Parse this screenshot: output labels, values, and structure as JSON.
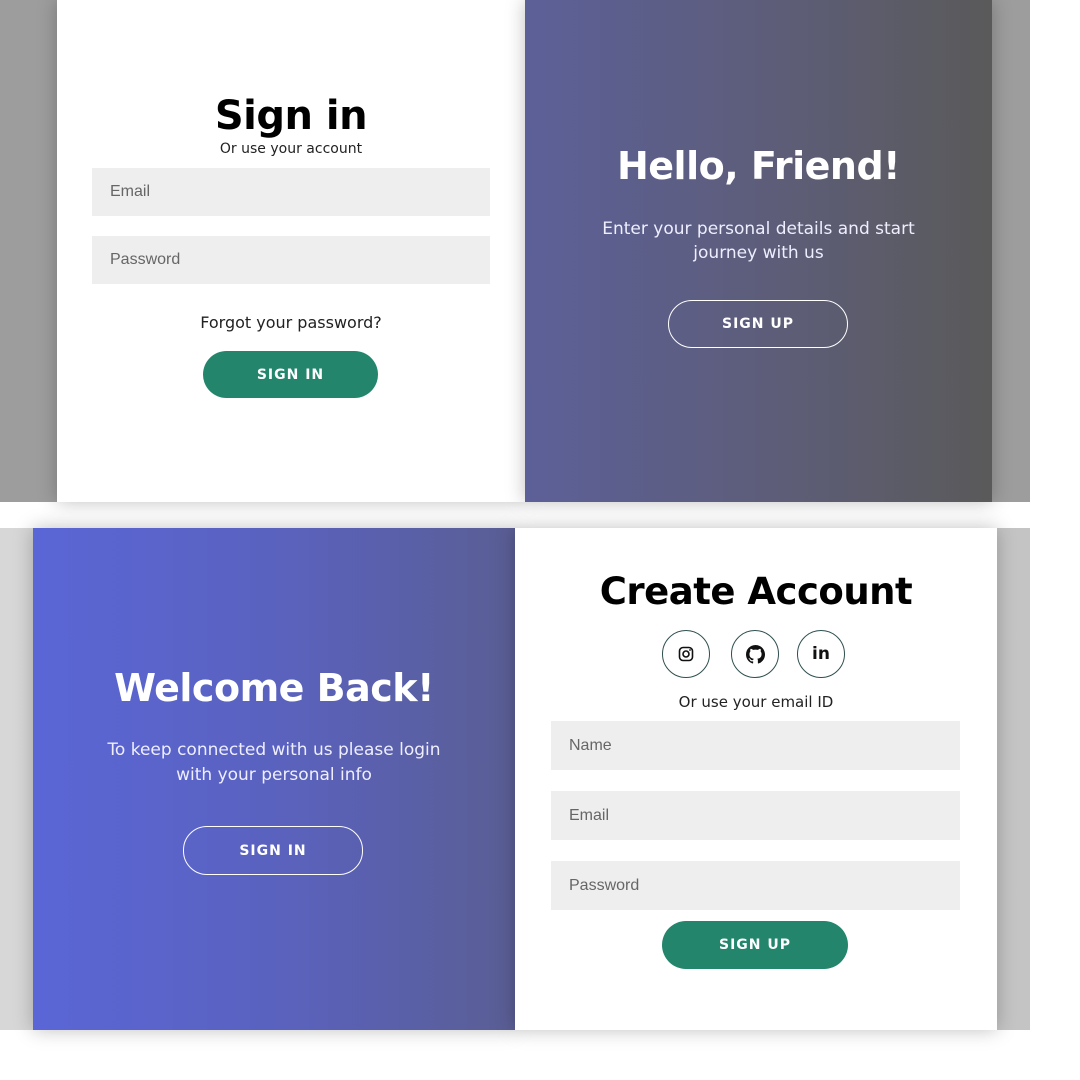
{
  "sign_in_panel": {
    "title": "Sign in",
    "subtitle": "Or use your account",
    "email_placeholder": "Email",
    "password_placeholder": "Password",
    "forgot_link": "Forgot your password?",
    "button_label": "SIGN IN"
  },
  "hello_panel": {
    "title": "Hello, Friend!",
    "text_line1": "Enter your personal details and start",
    "text_line2": "journey with us",
    "button_label": "SIGN UP"
  },
  "welcome_panel": {
    "title": "Welcome Back!",
    "text_line1": "To keep connected with us please login",
    "text_line2": "with your personal info",
    "button_label": "SIGN IN"
  },
  "create_panel": {
    "title": "Create Account",
    "social": [
      {
        "icon": "instagram-icon"
      },
      {
        "icon": "github-icon"
      },
      {
        "icon": "linkedin-icon",
        "text": "in"
      }
    ],
    "subtitle": "Or use your email ID",
    "name_placeholder": "Name",
    "email_placeholder": "Email",
    "password_placeholder": "Password",
    "button_label": "SIGN UP"
  },
  "colors": {
    "accent_green": "#22856c",
    "field_bg": "#eeeeee",
    "overlay_top_start": "#5c6098",
    "overlay_top_end": "#5a5a5a",
    "overlay_bottom_start": "#5a66d6",
    "overlay_bottom_end": "#5a5e94"
  }
}
